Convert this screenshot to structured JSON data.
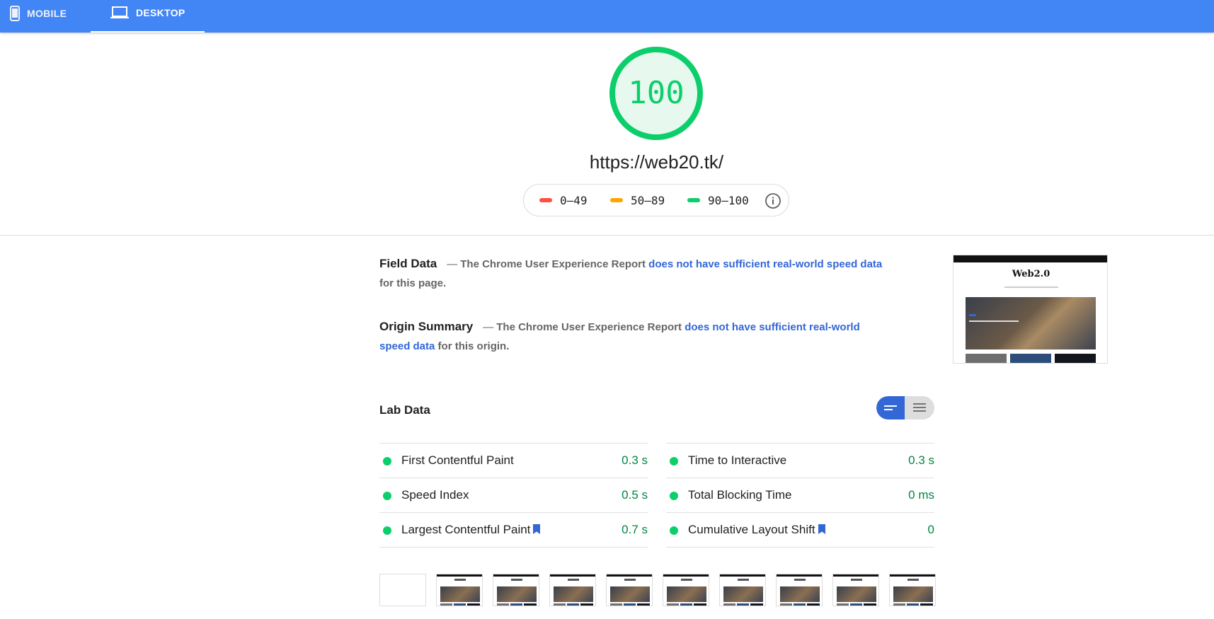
{
  "tabs": [
    {
      "label": "MOBILE",
      "icon": "mobile-phone-icon",
      "active": false
    },
    {
      "label": "DESKTOP",
      "icon": "laptop-icon",
      "active": true
    }
  ],
  "score": {
    "value": "100",
    "color": "#0cce6b",
    "fraction": 1.0
  },
  "url": "https://web20.tk/",
  "legend": [
    {
      "label": "0–49",
      "color": "#ff4e42"
    },
    {
      "label": "50–89",
      "color": "#ffa400"
    },
    {
      "label": "90–100",
      "color": "#0cce6b"
    }
  ],
  "field_data": {
    "title": "Field Data",
    "pre": "The Chrome User Experience Report",
    "link": "does not have sufficient real-world speed data",
    "post": "for this page."
  },
  "origin_summary": {
    "title": "Origin Summary",
    "pre": "The Chrome User Experience Report",
    "link": "does not have sufficient real-world speed data",
    "post": "for this origin."
  },
  "screenshot": {
    "site_title": "Web2.0"
  },
  "lab_data": {
    "title": "Lab Data",
    "metrics_left": [
      {
        "name": "First Contentful Paint",
        "value": "0.3 s",
        "bookmark": false
      },
      {
        "name": "Speed Index",
        "value": "0.5 s",
        "bookmark": false
      },
      {
        "name": "Largest Contentful Paint",
        "value": "0.7 s",
        "bookmark": true
      }
    ],
    "metrics_right": [
      {
        "name": "Time to Interactive",
        "value": "0.3 s",
        "bookmark": false
      },
      {
        "name": "Total Blocking Time",
        "value": "0 ms",
        "bookmark": false
      },
      {
        "name": "Cumulative Layout Shift",
        "value": "0",
        "bookmark": true
      }
    ]
  },
  "colors": {
    "accent": "#4285f4",
    "pass": "#0cce6b",
    "link": "#3367d6"
  }
}
